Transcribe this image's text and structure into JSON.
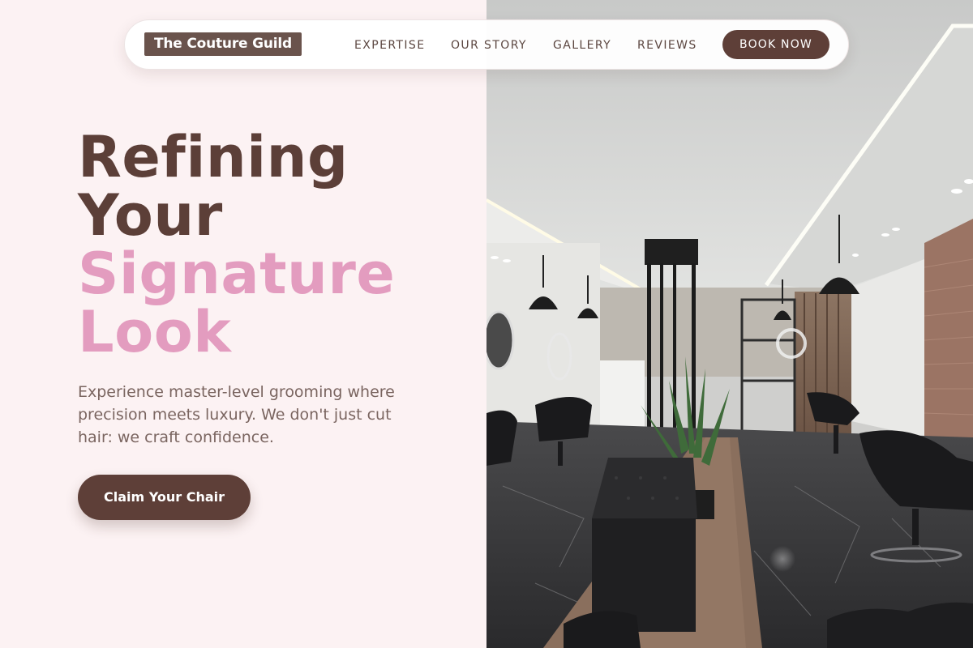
{
  "nav": {
    "logo": "The Couture Guild",
    "links": [
      "EXPERTISE",
      "OUR STORY",
      "GALLERY",
      "REVIEWS"
    ],
    "book_label": "BOOK NOW"
  },
  "hero": {
    "headline_line1": "Refining",
    "headline_line2": "Your",
    "headline_line3": "Signature",
    "headline_line4": "Look",
    "subtext": "Experience master-level grooming where precision meets luxury. We don't just cut hair: we craft confidence.",
    "cta_label": "Claim Your Chair"
  },
  "photo": {
    "description_icon": "salon-interior-photo"
  },
  "colors": {
    "background": "#fcf2f3",
    "brand_brown": "#5e3f38",
    "accent_pink": "#e39cbf",
    "body_text": "#7a6560"
  }
}
